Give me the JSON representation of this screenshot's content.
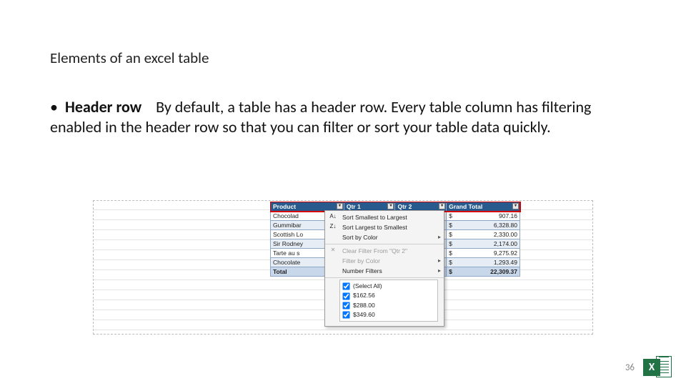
{
  "title": "Elements of an excel table",
  "bullet": "•",
  "term": "Header row",
  "body_rest": "By default, a table has a header row. Every table column has filtering enabled in the header row so that you can filter or sort your table data quickly.",
  "page_number": "36",
  "logo_letter": "X",
  "table": {
    "headers": [
      "Product",
      "Qtr 1",
      "Qtr 2",
      "Grand Total"
    ],
    "rows": [
      {
        "product": "Chocolad",
        "gt": "907.16"
      },
      {
        "product": "Gummibar",
        "gt": "6,328.80"
      },
      {
        "product": "Scottish Lo",
        "gt": "2,330.00"
      },
      {
        "product": "Sir Rodney",
        "gt": "2,174.00"
      },
      {
        "product": "Tarte au s",
        "gt": "9,275.92"
      },
      {
        "product": "Chocolate",
        "gt": "1,293.49"
      }
    ],
    "total_label": "Total",
    "total_value": "22,309.37"
  },
  "menu": {
    "sort_asc": "Sort Smallest to Largest",
    "sort_desc": "Sort Largest to Smallest",
    "sort_color": "Sort by Color",
    "clear": "Clear Filter From \"Qtr 2\"",
    "filt_color": "Filter by Color",
    "num_filt": "Number Filters",
    "checks": [
      "(Select All)",
      "$162.56",
      "$288.00",
      "$349.60"
    ]
  }
}
